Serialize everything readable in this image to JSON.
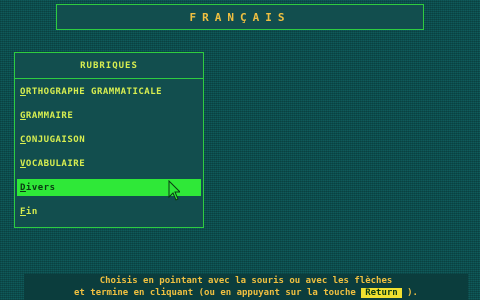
{
  "app": {
    "title": "FRANÇAIS"
  },
  "menu": {
    "header": "RUBRIQUES",
    "items": [
      {
        "first": "O",
        "rest": "RTHOGRAPHE GRAMMATICALE",
        "selected": false
      },
      {
        "first": "G",
        "rest": "RAMMAIRE",
        "selected": false
      },
      {
        "first": "C",
        "rest": "ONJUGAISON",
        "selected": false
      },
      {
        "first": "V",
        "rest": "OCABULAIRE",
        "selected": false
      },
      {
        "first": "D",
        "rest": "ivers",
        "selected": true
      },
      {
        "first": "F",
        "rest": "in",
        "selected": false
      }
    ]
  },
  "footer": {
    "line1": "Choisis en pointant avec la souris ou avec les flèches",
    "line2_prefix": "et termine en cliquant (ou en appuyant sur la touche",
    "key_label": "Return",
    "line2_suffix": ")."
  },
  "colors": {
    "background": "#0f5a5a",
    "border": "#2ecc40",
    "text_yellow": "#d8ee50",
    "title_yellow": "#f0c040",
    "selection": "#2fe838"
  }
}
